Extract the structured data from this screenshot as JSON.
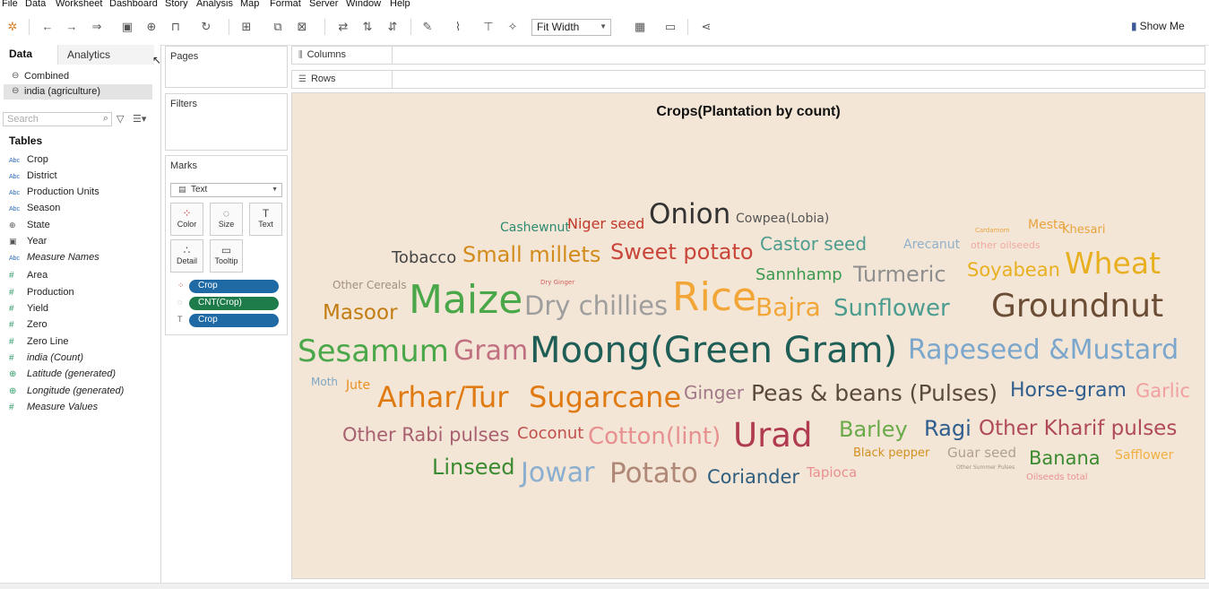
{
  "menu": [
    "File",
    "Data",
    "Worksheet",
    "Dashboard",
    "Story",
    "Analysis",
    "Map",
    "Format",
    "Server",
    "Window",
    "Help"
  ],
  "toolbar": {
    "fit_label": "Fit Width",
    "show_me": "Show Me"
  },
  "datapane": {
    "tabs": [
      "Data",
      "Analytics"
    ],
    "sources": [
      "Combined",
      "india (agriculture)"
    ],
    "search_placeholder": "Search",
    "tables_heading": "Tables",
    "fields": [
      {
        "name": "Crop",
        "type": "Abc"
      },
      {
        "name": "District",
        "type": "Abc"
      },
      {
        "name": "Production Units",
        "type": "Abc"
      },
      {
        "name": "Season",
        "type": "Abc"
      },
      {
        "name": "State",
        "type": "geo"
      },
      {
        "name": "Year",
        "type": "date"
      },
      {
        "name": "Measure Names",
        "type": "Abc"
      },
      {
        "name": "Area",
        "type": "#"
      },
      {
        "name": "Production",
        "type": "#"
      },
      {
        "name": "Yield",
        "type": "#"
      },
      {
        "name": "Zero",
        "type": "#"
      },
      {
        "name": "Zero Line",
        "type": "#"
      },
      {
        "name": "india (Count)",
        "type": "#"
      },
      {
        "name": "Latitude (generated)",
        "type": "geo"
      },
      {
        "name": "Longitude (generated)",
        "type": "geo"
      },
      {
        "name": "Measure Values",
        "type": "#"
      }
    ]
  },
  "cards": {
    "pages": "Pages",
    "filters": "Filters",
    "marks": "Marks",
    "mark_type": "Text",
    "buttons": [
      "Color",
      "Size",
      "Text",
      "Detail",
      "Tooltip"
    ],
    "pills": [
      "Crop",
      "CNT(Crop)",
      "Crop"
    ]
  },
  "shelves": {
    "columns": "Columns",
    "rows": "Rows"
  },
  "viz": {
    "title": "Crops(Plantation by count)",
    "words": [
      {
        "t": "Cashewnut",
        "c": "#2e8b72"
      },
      {
        "t": "Niger seed",
        "c": "#c0392b"
      },
      {
        "t": "Onion",
        "c": "#333333"
      },
      {
        "t": "Cowpea(Lobia)",
        "c": "#555555"
      },
      {
        "t": "Cardamom",
        "c": "#e8a33d"
      },
      {
        "t": "Mesta",
        "c": "#e8a33d"
      },
      {
        "t": "Khesari",
        "c": "#e8a33d"
      },
      {
        "t": "Tobacco",
        "c": "#444444"
      },
      {
        "t": "Small millets",
        "c": "#d38b1c"
      },
      {
        "t": "Sweet potato",
        "c": "#c9453a"
      },
      {
        "t": "Castor seed",
        "c": "#4c9c8f"
      },
      {
        "t": "Arecanut",
        "c": "#8fb1cc"
      },
      {
        "t": "other oilseeds",
        "c": "#f0a9a0"
      },
      {
        "t": "Sannhamp",
        "c": "#3a9a50"
      },
      {
        "t": "Turmeric",
        "c": "#8e8e8e"
      },
      {
        "t": "Soyabean",
        "c": "#e8b020"
      },
      {
        "t": "Wheat",
        "c": "#e8b020"
      },
      {
        "t": "Other Cereals",
        "c": "#a09080"
      },
      {
        "t": "Dry Ginger",
        "c": "#d06060"
      },
      {
        "t": "Masoor",
        "c": "#c27d12"
      },
      {
        "t": "Maize",
        "c": "#4aa84a"
      },
      {
        "t": "Dry chillies",
        "c": "#9e9e9e"
      },
      {
        "t": "Rice",
        "c": "#f1a637"
      },
      {
        "t": "Bajra",
        "c": "#f1a637"
      },
      {
        "t": "Sunflower",
        "c": "#4c9c8f"
      },
      {
        "t": "Groundnut",
        "c": "#6b4c35"
      },
      {
        "t": "Sesamum",
        "c": "#4aa84a"
      },
      {
        "t": "Gram",
        "c": "#c07080"
      },
      {
        "t": "Moong(Green Gram)",
        "c": "#1f5e57"
      },
      {
        "t": "Rapeseed &Mustard",
        "c": "#7ca7cc"
      },
      {
        "t": "Moth",
        "c": "#7fa7c4"
      },
      {
        "t": "Jute",
        "c": "#e89020"
      },
      {
        "t": "Arhar/Tur",
        "c": "#e07b14"
      },
      {
        "t": "Sugarcane",
        "c": "#e07b14"
      },
      {
        "t": "Ginger",
        "c": "#a07888"
      },
      {
        "t": "Peas & beans (Pulses)",
        "c": "#5a4a3a"
      },
      {
        "t": "Horse-gram",
        "c": "#2e5d8e"
      },
      {
        "t": "Garlic",
        "c": "#f0a0a0"
      },
      {
        "t": "Other Rabi pulses",
        "c": "#a86070"
      },
      {
        "t": "Coconut",
        "c": "#c0504d"
      },
      {
        "t": "Cotton(lint)",
        "c": "#e69090"
      },
      {
        "t": "Urad",
        "c": "#b03a50"
      },
      {
        "t": "Barley",
        "c": "#6aaa4a"
      },
      {
        "t": "Ragi",
        "c": "#2e5d8e"
      },
      {
        "t": "Other Kharif pulses",
        "c": "#b04a5a"
      },
      {
        "t": "Black pepper",
        "c": "#d09020"
      },
      {
        "t": "Guar seed",
        "c": "#b0a090"
      },
      {
        "t": "Banana",
        "c": "#3a8a30"
      },
      {
        "t": "Safflower",
        "c": "#f0b040"
      },
      {
        "t": "Linseed",
        "c": "#3a8a30"
      },
      {
        "t": "Jowar",
        "c": "#8aaed0"
      },
      {
        "t": "Potato",
        "c": "#b08878"
      },
      {
        "t": "Coriander",
        "c": "#2e5d7e"
      },
      {
        "t": "Tapioca",
        "c": "#e89090"
      },
      {
        "t": "Other Summer Pulses",
        "c": "#a09080"
      },
      {
        "t": "Oilseeds total",
        "c": "#e89090"
      }
    ]
  }
}
